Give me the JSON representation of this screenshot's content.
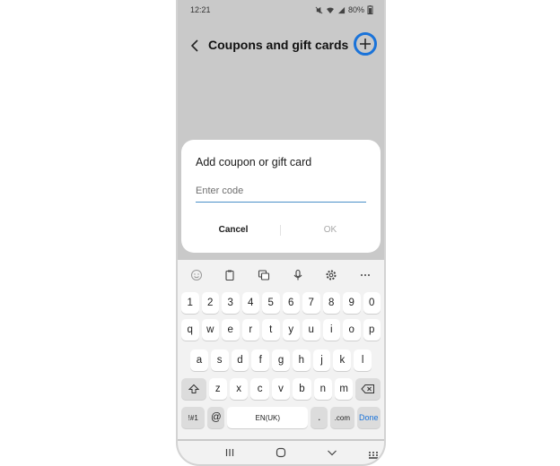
{
  "status": {
    "time": "12:21",
    "battery": "80%"
  },
  "header": {
    "title": "Coupons and gift cards"
  },
  "dialog": {
    "title": "Add coupon or gift card",
    "placeholder": "Enter code",
    "cancel": "Cancel",
    "ok": "OK"
  },
  "keyboard": {
    "numbers": [
      "1",
      "2",
      "3",
      "4",
      "5",
      "6",
      "7",
      "8",
      "9",
      "0"
    ],
    "row1": [
      "q",
      "w",
      "e",
      "r",
      "t",
      "y",
      "u",
      "i",
      "o",
      "p"
    ],
    "row2": [
      "a",
      "s",
      "d",
      "f",
      "g",
      "h",
      "j",
      "k",
      "l"
    ],
    "row3": [
      "z",
      "x",
      "c",
      "v",
      "b",
      "n",
      "m"
    ],
    "symbols": "!#1",
    "at": "@",
    "space": "EN(UK)",
    "dot": ".",
    "com": ".com",
    "done": "Done"
  },
  "colors": {
    "accent": "#1a73d9",
    "overlay": "#c9c9c9"
  }
}
